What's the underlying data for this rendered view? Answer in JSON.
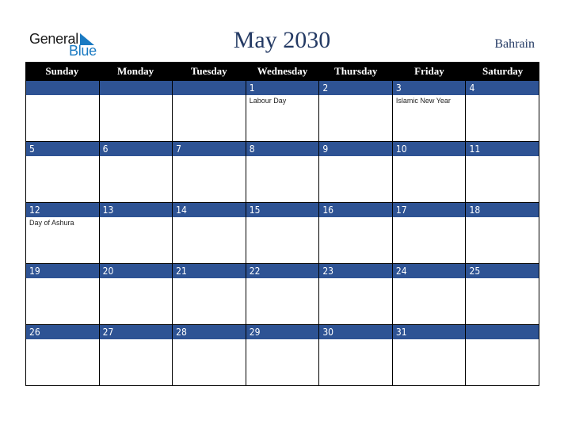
{
  "brand": {
    "word1": "General",
    "word2": "Blue",
    "accent": "#1a7ac2"
  },
  "header": {
    "title": "May 2030",
    "country": "Bahrain"
  },
  "colors": {
    "band": "#2e5394",
    "header_bg": "#000000",
    "title": "#243a64"
  },
  "weekdays": [
    "Sunday",
    "Monday",
    "Tuesday",
    "Wednesday",
    "Thursday",
    "Friday",
    "Saturday"
  ],
  "weeks": [
    [
      {
        "day": "",
        "event": ""
      },
      {
        "day": "",
        "event": ""
      },
      {
        "day": "",
        "event": ""
      },
      {
        "day": "1",
        "event": "Labour Day"
      },
      {
        "day": "2",
        "event": ""
      },
      {
        "day": "3",
        "event": "Islamic New Year"
      },
      {
        "day": "4",
        "event": ""
      }
    ],
    [
      {
        "day": "5",
        "event": ""
      },
      {
        "day": "6",
        "event": ""
      },
      {
        "day": "7",
        "event": ""
      },
      {
        "day": "8",
        "event": ""
      },
      {
        "day": "9",
        "event": ""
      },
      {
        "day": "10",
        "event": ""
      },
      {
        "day": "11",
        "event": ""
      }
    ],
    [
      {
        "day": "12",
        "event": "Day of Ashura"
      },
      {
        "day": "13",
        "event": ""
      },
      {
        "day": "14",
        "event": ""
      },
      {
        "day": "15",
        "event": ""
      },
      {
        "day": "16",
        "event": ""
      },
      {
        "day": "17",
        "event": ""
      },
      {
        "day": "18",
        "event": ""
      }
    ],
    [
      {
        "day": "19",
        "event": ""
      },
      {
        "day": "20",
        "event": ""
      },
      {
        "day": "21",
        "event": ""
      },
      {
        "day": "22",
        "event": ""
      },
      {
        "day": "23",
        "event": ""
      },
      {
        "day": "24",
        "event": ""
      },
      {
        "day": "25",
        "event": ""
      }
    ],
    [
      {
        "day": "26",
        "event": ""
      },
      {
        "day": "27",
        "event": ""
      },
      {
        "day": "28",
        "event": ""
      },
      {
        "day": "29",
        "event": ""
      },
      {
        "day": "30",
        "event": ""
      },
      {
        "day": "31",
        "event": ""
      },
      {
        "day": "",
        "event": ""
      }
    ]
  ]
}
